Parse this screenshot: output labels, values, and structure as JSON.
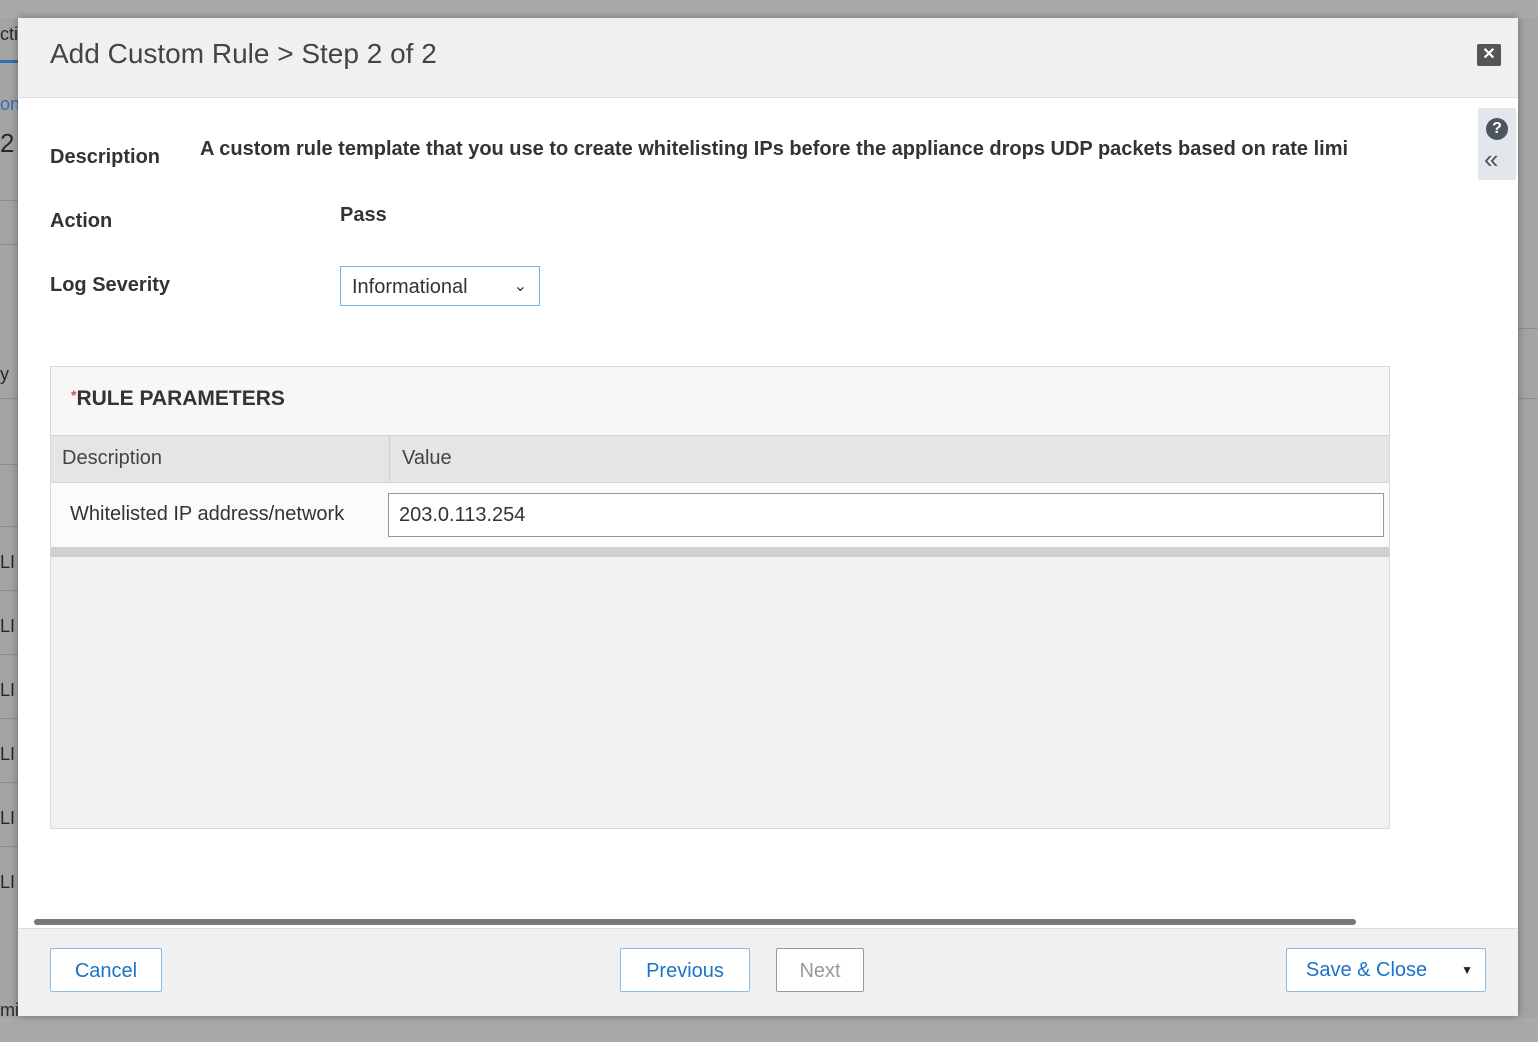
{
  "background": {
    "fragments": [
      "cti",
      "on",
      "2",
      "y",
      "LI",
      "LI",
      "LI",
      "LI",
      "LI",
      "LI",
      "mi"
    ]
  },
  "modal": {
    "title": "Add Custom Rule > Step 2 of 2",
    "close_icon": "close-icon",
    "help_icon": "help-icon",
    "collapse_icon": "double-chevron-left-icon"
  },
  "fields": {
    "description_label": "Description",
    "description_value": "A custom rule template that you use to create whitelisting IPs before the appliance drops UDP packets based on rate limi",
    "action_label": "Action",
    "action_value": "Pass",
    "log_severity_label": "Log Severity",
    "log_severity_value": "Informational"
  },
  "rule_parameters": {
    "required_marker": "*",
    "title": "RULE PARAMETERS",
    "columns": [
      "Description",
      "Value"
    ],
    "rows": [
      {
        "description": "Whitelisted IP address/network",
        "value": "203.0.113.254"
      }
    ]
  },
  "footer": {
    "cancel_label": "Cancel",
    "previous_label": "Previous",
    "next_label": "Next",
    "save_close_label": "Save & Close"
  },
  "colors": {
    "accent": "#1a73c8",
    "required": "#d9534f",
    "header_bg": "#f0f0f0"
  }
}
